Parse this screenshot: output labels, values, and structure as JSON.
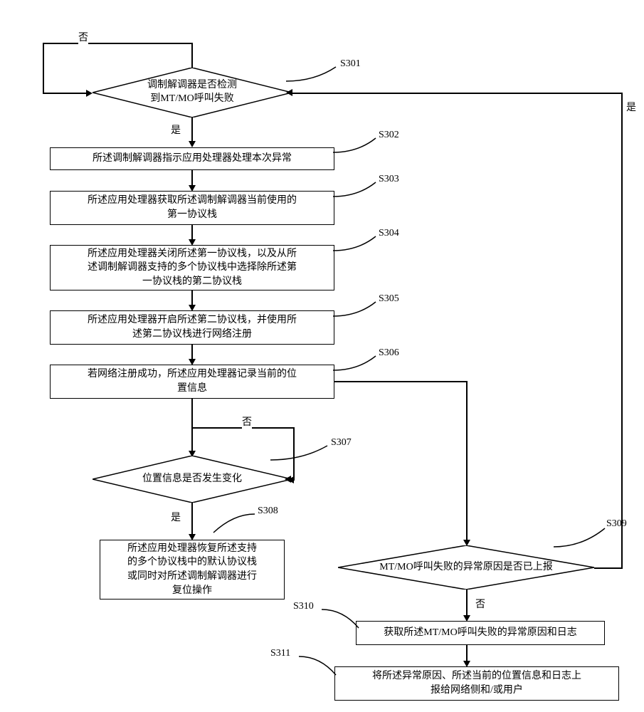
{
  "labels": {
    "yes": "是",
    "no": "否"
  },
  "steps": {
    "s301": {
      "tag": "S301",
      "text": "调制解调器是否检测\n到MT/MO呼叫失败"
    },
    "s302": {
      "tag": "S302",
      "text": "所述调制解调器指示应用处理器处理本次异常"
    },
    "s303": {
      "tag": "S303",
      "text": "所述应用处理器获取所述调制解调器当前使用的\n第一协议栈"
    },
    "s304": {
      "tag": "S304",
      "text": "所述应用处理器关闭所述第一协议栈，以及从所\n述调制解调器支持的多个协议栈中选择除所述第\n一协议栈的第二协议栈"
    },
    "s305": {
      "tag": "S305",
      "text": "所述应用处理器开启所述第二协议栈，并使用所\n述第二协议栈进行网络注册"
    },
    "s306": {
      "tag": "S306",
      "text": "若网络注册成功，所述应用处理器记录当前的位\n置信息"
    },
    "s307": {
      "tag": "S307",
      "text": "位置信息是否发生变化"
    },
    "s308": {
      "tag": "S308",
      "text": "所述应用处理器恢复所述支持\n的多个协议栈中的默认协议栈\n或同时对所述调制解调器进行\n复位操作"
    },
    "s309": {
      "tag": "S309",
      "text": "MT/MO呼叫失败的异常原因是否已上报"
    },
    "s310": {
      "tag": "S310",
      "text": "获取所述MT/MO呼叫失败的异常原因和日志"
    },
    "s311": {
      "tag": "S311",
      "text": "将所述异常原因、所述当前的位置信息和日志上\n报给网络侧和/或用户"
    }
  },
  "chart_data": {
    "type": "flowchart",
    "nodes": [
      {
        "id": "S301",
        "shape": "decision",
        "text": "调制解调器是否检测到MT/MO呼叫失败"
      },
      {
        "id": "S302",
        "shape": "process",
        "text": "所述调制解调器指示应用处理器处理本次异常"
      },
      {
        "id": "S303",
        "shape": "process",
        "text": "所述应用处理器获取所述调制解调器当前使用的第一协议栈"
      },
      {
        "id": "S304",
        "shape": "process",
        "text": "所述应用处理器关闭所述第一协议栈，以及从所述调制解调器支持的多个协议栈中选择除所述第一协议栈的第二协议栈"
      },
      {
        "id": "S305",
        "shape": "process",
        "text": "所述应用处理器开启所述第二协议栈，并使用所述第二协议栈进行网络注册"
      },
      {
        "id": "S306",
        "shape": "process",
        "text": "若网络注册成功，所述应用处理器记录当前的位置信息"
      },
      {
        "id": "S307",
        "shape": "decision",
        "text": "位置信息是否发生变化"
      },
      {
        "id": "S308",
        "shape": "process",
        "text": "所述应用处理器恢复所述支持的多个协议栈中的默认协议栈或同时对所述调制解调器进行复位操作"
      },
      {
        "id": "S309",
        "shape": "decision",
        "text": "MT/MO呼叫失败的异常原因是否已上报"
      },
      {
        "id": "S310",
        "shape": "process",
        "text": "获取所述MT/MO呼叫失败的异常原因和日志"
      },
      {
        "id": "S311",
        "shape": "process",
        "text": "将所述异常原因、所述当前的位置信息和日志上报给网络侧和/或用户"
      }
    ],
    "edges": [
      {
        "from": "S301",
        "to": "S301",
        "label": "否"
      },
      {
        "from": "S301",
        "to": "S302",
        "label": "是"
      },
      {
        "from": "S302",
        "to": "S303"
      },
      {
        "from": "S303",
        "to": "S304"
      },
      {
        "from": "S304",
        "to": "S305"
      },
      {
        "from": "S305",
        "to": "S306"
      },
      {
        "from": "S306",
        "to": "S307"
      },
      {
        "from": "S306",
        "to": "S309"
      },
      {
        "from": "S307",
        "to": "S307",
        "label": "否"
      },
      {
        "from": "S307",
        "to": "S308",
        "label": "是"
      },
      {
        "from": "S309",
        "to": "S301",
        "label": "是"
      },
      {
        "from": "S309",
        "to": "S310",
        "label": "否"
      },
      {
        "from": "S310",
        "to": "S311"
      }
    ]
  }
}
